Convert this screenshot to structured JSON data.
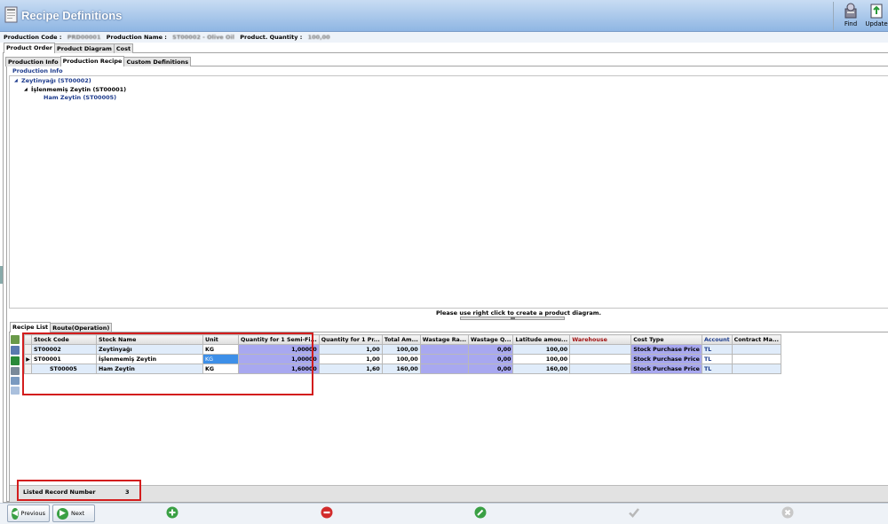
{
  "window": {
    "title": "Recipe Definitions"
  },
  "toolbar": {
    "find_label": "Find",
    "update_label": "Update"
  },
  "info_bar": {
    "production_code_label": "Production Code :",
    "production_code_value": "PRD00001",
    "production_name_label": "Production Name :",
    "production_name_value": "ST00002 - Olive Oil",
    "product_quantity_label": "Product. Quantity :",
    "product_quantity_value": "100,00"
  },
  "main_tabs": [
    "Product Order",
    "Product Diagram",
    "Cost"
  ],
  "sub_tabs": [
    "Production Info",
    "Production Recipe",
    "Custom Definitions"
  ],
  "production_info_label": "Production Info",
  "tree": {
    "nodes": [
      {
        "toggle": "◢",
        "label": "Zeytinyağı (ST00002)"
      },
      {
        "toggle": "◢",
        "label": "İşlenmemiş Zeytin (ST00001)"
      },
      {
        "toggle": "",
        "label": "Ham Zeytin (ST00005)"
      }
    ]
  },
  "hint": "Please use right click to create a product diagram.",
  "grid_tabs": [
    "Recipe List",
    "Route(Operation)"
  ],
  "grid": {
    "columns": [
      "Stock Code",
      "Stock Name",
      "Unit",
      "Quantity for 1 Semi-Fi...",
      "Quantity for 1 Pr...",
      "Total Am...",
      "Wastage Ra...",
      "Wastage Q...",
      "Latitude amou...",
      "Warehouse",
      "Cost Type",
      "Account",
      "Contract Ma..."
    ],
    "rows": [
      {
        "indicator": "",
        "stock_code": "ST00002",
        "stock_name": "Zeytinyağı",
        "unit": "KG",
        "qty_semi": "1,00000",
        "qty_prod": "1,00",
        "total": "100,00",
        "wastage_rate": "",
        "wastage_qty": "0,00",
        "latitude": "100,00",
        "warehouse": "",
        "cost_type": "Stock Purchase Price",
        "account": "TL",
        "contract": ""
      },
      {
        "indicator": "▶",
        "stock_code": "ST00001",
        "stock_name": "İşlenmemiş Zeytin",
        "unit": "KG",
        "qty_semi": "1,00000",
        "qty_prod": "1,00",
        "total": "100,00",
        "wastage_rate": "",
        "wastage_qty": "0,00",
        "latitude": "100,00",
        "warehouse": "",
        "cost_type": "Stock Purchase Price",
        "account": "TL",
        "contract": ""
      },
      {
        "indicator": "",
        "stock_code": "ST00005",
        "stock_name": "Ham Zeytin",
        "unit": "KG",
        "qty_semi": "1,60000",
        "qty_prod": "1,60",
        "total": "160,00",
        "wastage_rate": "",
        "wastage_qty": "0,00",
        "latitude": "160,00",
        "warehouse": "",
        "cost_type": "Stock Purchase Price",
        "account": "TL",
        "contract": ""
      }
    ]
  },
  "footer": {
    "listed_label": "Listed Record Number",
    "listed_count": "3"
  },
  "nav": {
    "previous_label": "Previous",
    "next_label": "Next"
  },
  "colors": {
    "highlight_red": "#d31d1d",
    "title_blue": "#8fb6e3",
    "qty_purple": "#a8a8f0"
  }
}
